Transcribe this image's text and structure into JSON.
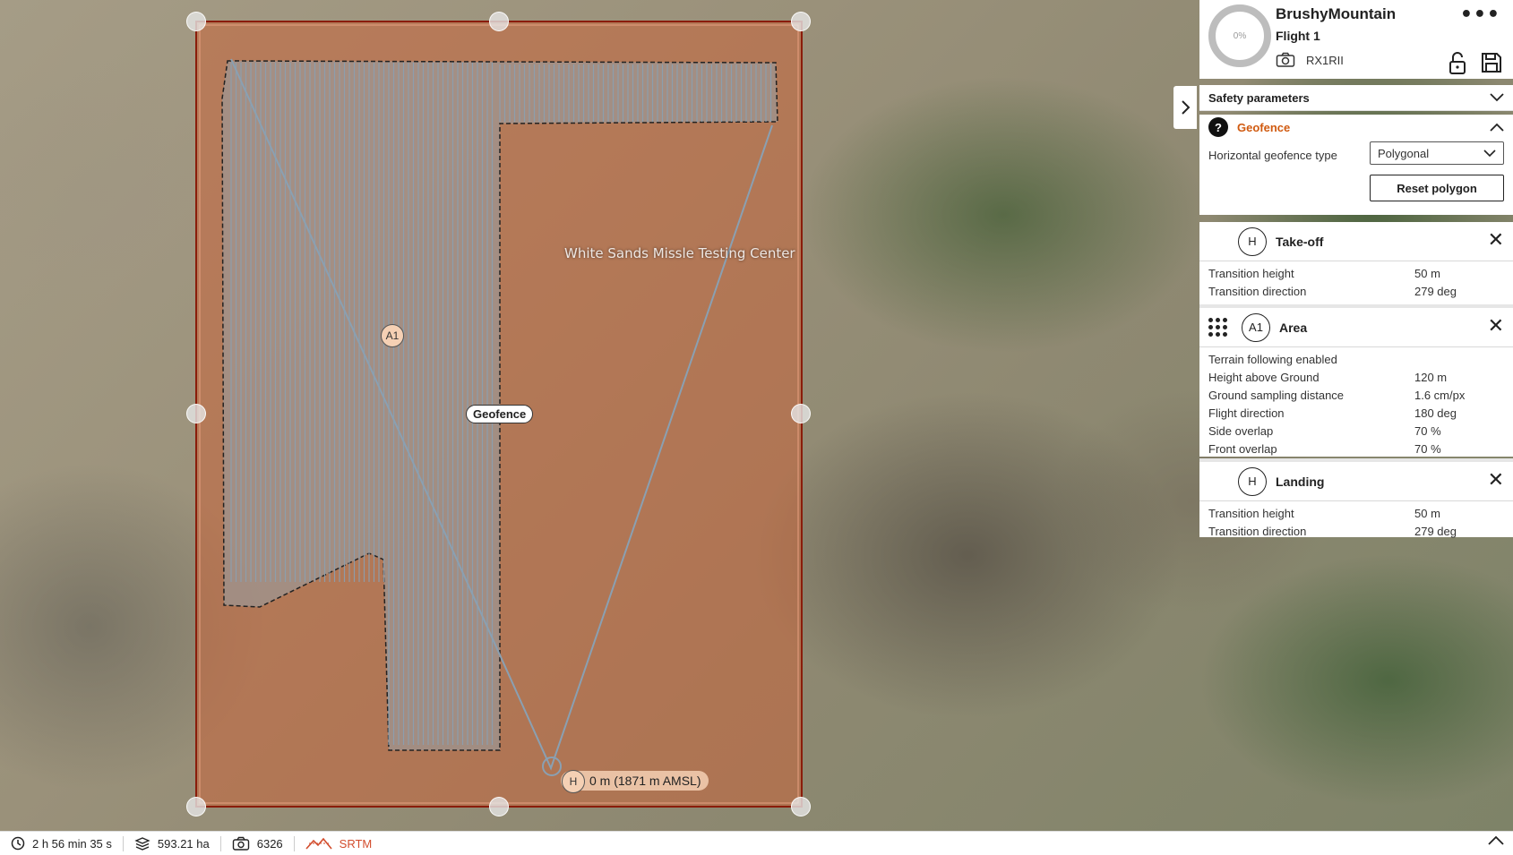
{
  "map": {
    "area_label": "White Sands Missle Testing Center",
    "geofence_tag": "Geofence",
    "area_marker": "A1",
    "home_marker": "H",
    "home_altitude": "0 m (1871 m AMSL)",
    "colors": {
      "geofence_fill": "#c8643a",
      "geofence_border": "#8a1c0a",
      "flight_path": "#8aa0b2"
    }
  },
  "header": {
    "progress": "0%",
    "project_name": "BrushyMountain",
    "flight_name": "Flight 1",
    "camera_model": "RX1RII",
    "icons": [
      "camera-icon",
      "unlock-icon",
      "save-icon",
      "more-icon"
    ]
  },
  "safety": {
    "title": "Safety parameters"
  },
  "geofence": {
    "title": "Geofence",
    "type_label": "Horizontal geofence type",
    "type_value": "Polygonal",
    "reset_label": "Reset polygon"
  },
  "takeoff": {
    "badge": "H",
    "title": "Take-off",
    "rows": [
      {
        "k": "Transition height",
        "v": "50 m"
      },
      {
        "k": "Transition direction",
        "v": "279 deg"
      }
    ]
  },
  "area": {
    "badge": "A1",
    "title": "Area",
    "terrain": "Terrain following enabled",
    "rows": [
      {
        "k": "Height above Ground",
        "v": "120 m"
      },
      {
        "k": "Ground sampling distance",
        "v": "1.6 cm/px"
      },
      {
        "k": "Flight direction",
        "v": "180 deg"
      },
      {
        "k": "Side overlap",
        "v": "70 %"
      },
      {
        "k": "Front overlap",
        "v": "70 %"
      }
    ]
  },
  "landing": {
    "badge": "H",
    "title": "Landing",
    "rows": [
      {
        "k": "Transition height",
        "v": "50 m"
      },
      {
        "k": "Transition direction",
        "v": "279 deg"
      }
    ]
  },
  "status": {
    "duration": "2 h 56 min 35 s",
    "area": "593.21 ha",
    "photos": "6326",
    "elevation_source": "SRTM"
  }
}
